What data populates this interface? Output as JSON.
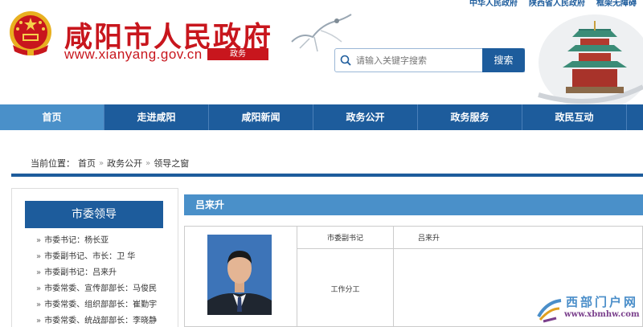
{
  "header": {
    "title": "咸阳市人民政府",
    "url": "www.xianyang.gov.cn",
    "tag": "政务",
    "toplinks": [
      "中华人民政府",
      "陕西省人民政府",
      "框架无障碍"
    ]
  },
  "search": {
    "placeholder": "请输入关键字搜索",
    "button": "搜索"
  },
  "nav": {
    "items": [
      "首页",
      "走进咸阳",
      "咸阳新闻",
      "政务公开",
      "政务服务",
      "政民互动"
    ],
    "active_color": "#4a90c9",
    "bar_color": "#1d5c9c"
  },
  "breadcrumb": {
    "prefix": "当前位置：",
    "items": [
      "首页",
      "政务公开",
      "领导之窗"
    ],
    "separator": "»"
  },
  "sidebar": {
    "title": "市委领导",
    "items": [
      "市委书记：杨长亚",
      "市委副书记、市长：卫 华",
      "市委副书记：吕来升",
      "市委常委、宣传部部长：马俊民",
      "市委常委、组织部部长：崔勤宇",
      "市委常委、统战部部长：李晓静"
    ]
  },
  "main": {
    "name_header": "吕来升",
    "table": {
      "position_label": "市委副书记",
      "position_value": "吕来升",
      "duty_label": "工作分工"
    }
  },
  "watermark": {
    "text": "西部门户网",
    "url": "www.xbmhw.com"
  }
}
